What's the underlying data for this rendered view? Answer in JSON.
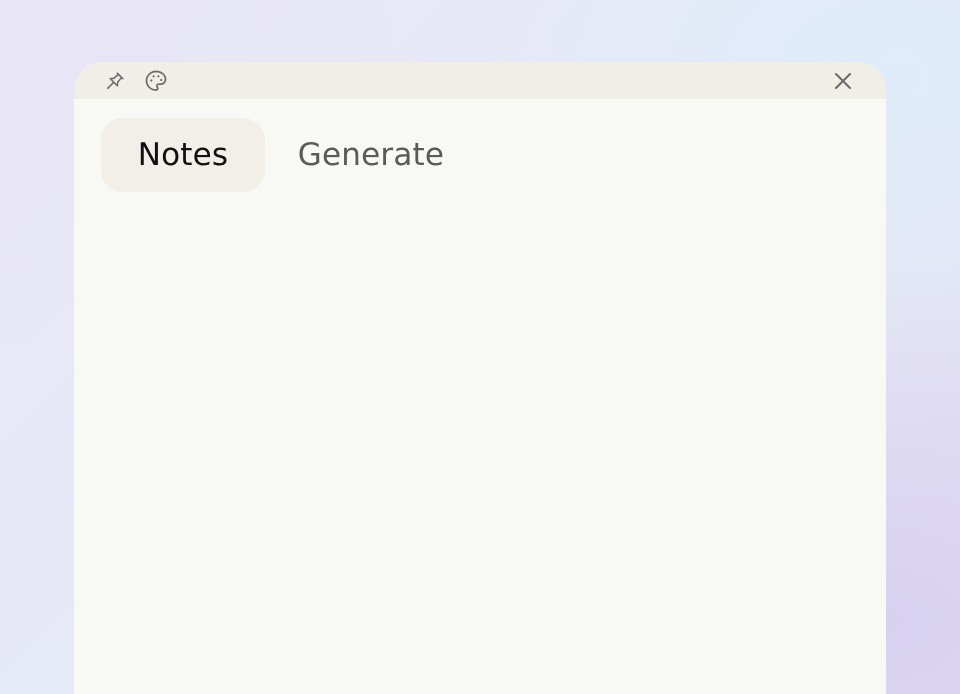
{
  "window": {
    "icons": {
      "pin": "pin-icon",
      "palette": "palette-icon",
      "close": "close-icon"
    }
  },
  "tabs": [
    {
      "label": "Notes",
      "selected": true
    },
    {
      "label": "Generate",
      "selected": false
    }
  ],
  "colors": {
    "panel_background": "#f8f9f5",
    "titlebar_background": "#f1eee8",
    "selected_tab_background": "#f2efe9",
    "icon_color": "#6b6b6b"
  }
}
